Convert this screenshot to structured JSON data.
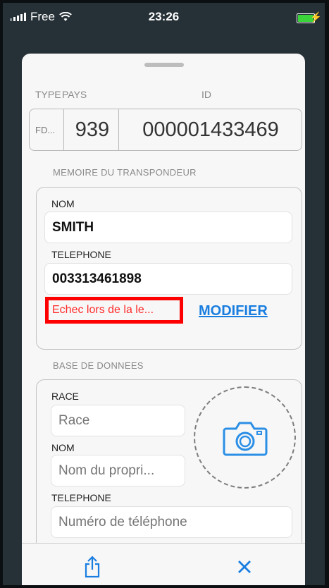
{
  "status_bar": {
    "carrier": "Free",
    "time": "23:26"
  },
  "header": {
    "type_label": "TYPE",
    "country_label": "PAYS",
    "id_label": "ID"
  },
  "identifier": {
    "type": "FD...",
    "country": "939",
    "id": "000001433469"
  },
  "transponder_memory": {
    "section_title": "MEMOIRE DU TRANSPONDEUR",
    "name_label": "NOM",
    "name_value": "SMITH",
    "phone_label": "TELEPHONE",
    "phone_value": "003313461898",
    "error_text": "Echec lors de la le...",
    "modify_label": "MODIFIER"
  },
  "database": {
    "section_title": "BASE DE DONNEES",
    "breed_label": "RACE",
    "breed_placeholder": "Race",
    "owner_label": "NOM",
    "owner_placeholder": "Nom du propri...",
    "phone_label": "TELEPHONE",
    "phone_placeholder": "Numéro de téléphone"
  },
  "icons": {
    "camera": "camera-icon",
    "share": "share-icon",
    "close": "close-icon"
  },
  "colors": {
    "accent": "#1a7ee0",
    "error": "#ff2b2b",
    "highlight_box": "#ff0000"
  }
}
